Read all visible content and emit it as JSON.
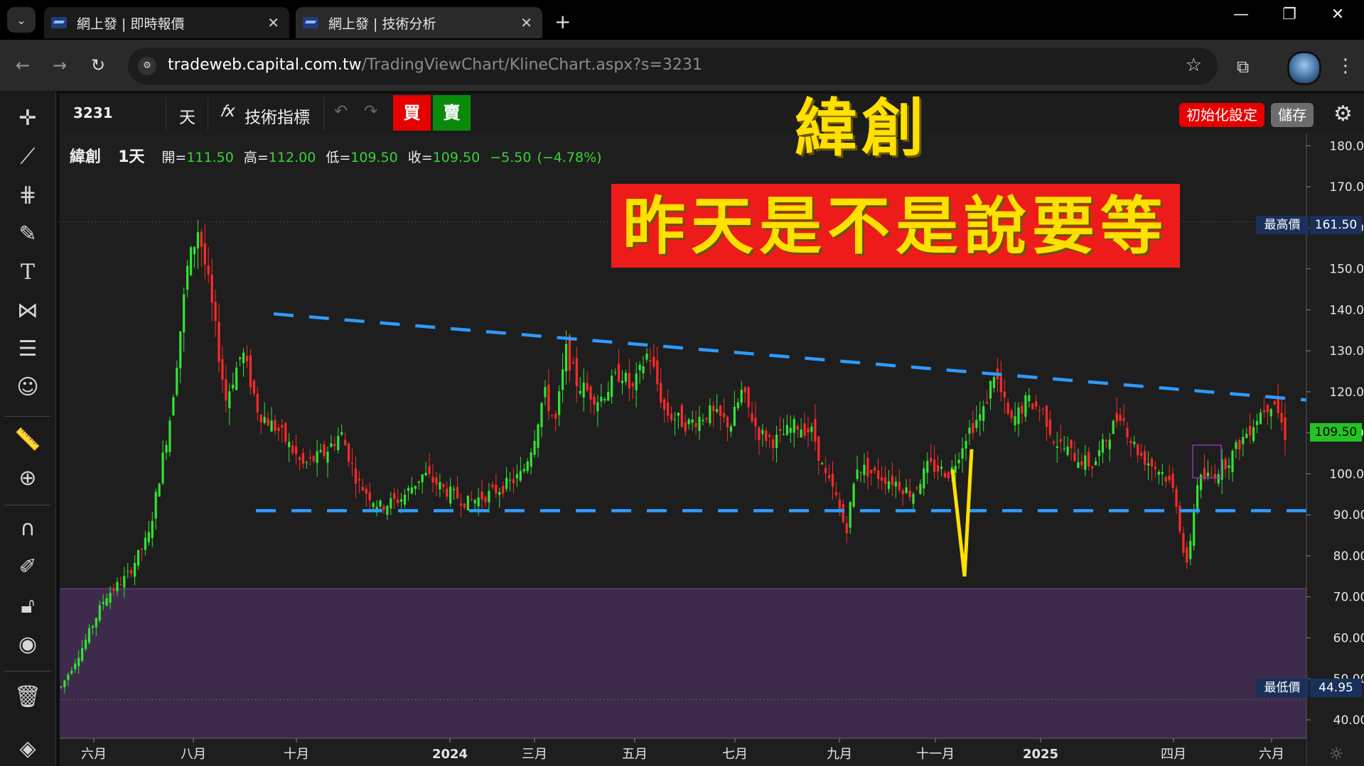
{
  "browser": {
    "tabs": [
      {
        "title": "網上發 | 即時報價",
        "close": "✕"
      },
      {
        "title": "網上發 | 技術分析",
        "close": "✕"
      }
    ],
    "new_tab": "+",
    "window": {
      "minimize": "—",
      "restore": "❐",
      "close": "✕"
    },
    "url_host": "tradeweb.capital.com.tw",
    "url_path": "/TradingViewChart/KlineChart.aspx?s=3231"
  },
  "toolbar": {
    "symbol": "3231",
    "interval": "天",
    "fx_icon": "𝑓x",
    "indicators": "技術指標",
    "buy": "買",
    "sell": "賣",
    "init_settings": "初始化設定",
    "save": "儲存"
  },
  "overlay": {
    "title": "緯創",
    "banner": "昨天是不是說要等"
  },
  "legend": {
    "name": "緯創",
    "interval": "1天",
    "open_label": "開=",
    "open": "111.50",
    "high_label": "高=",
    "high": "112.00",
    "low_label": "低=",
    "low": "109.50",
    "close_label": "收=",
    "close": "109.50",
    "change": "−5.50",
    "change_pct": "(−4.78%)"
  },
  "price_labels": {
    "high_name": "最高價",
    "high_value": "161.50",
    "low_name": "最低價",
    "low_value": "44.95",
    "last_value": "109.50"
  },
  "chart_data": {
    "type": "candlestick",
    "symbol": "3231",
    "y_ticks": [
      "180.00",
      "170.00",
      "160.00",
      "150.00",
      "140.00",
      "130.00",
      "120.00",
      "110.00",
      "100.00",
      "90.00",
      "80.00",
      "70.00",
      "60.00",
      "50.00",
      "40.00"
    ],
    "ylim": [
      35.5,
      183
    ],
    "x_ticks": [
      "六月",
      "八月",
      "十月",
      "2024",
      "三月",
      "五月",
      "七月",
      "九月",
      "十一月",
      "2025",
      "四月",
      "六月"
    ],
    "colors": {
      "up": "#33e333",
      "down": "#ff2a2a",
      "trendline": "#2e9bff",
      "zone": "#3e2a4a",
      "highlight": "#ffe000",
      "last_price": "#22c322"
    },
    "price_points": [
      [
        0,
        48
      ],
      [
        0.02,
        58
      ],
      [
        0.04,
        70
      ],
      [
        0.06,
        75
      ],
      [
        0.08,
        85
      ],
      [
        0.1,
        115
      ],
      [
        0.115,
        150
      ],
      [
        0.125,
        160
      ],
      [
        0.135,
        145
      ],
      [
        0.15,
        118
      ],
      [
        0.165,
        130
      ],
      [
        0.18,
        115
      ],
      [
        0.2,
        110
      ],
      [
        0.22,
        102
      ],
      [
        0.24,
        105
      ],
      [
        0.255,
        110
      ],
      [
        0.27,
        98
      ],
      [
        0.29,
        92
      ],
      [
        0.31,
        94
      ],
      [
        0.33,
        100
      ],
      [
        0.35,
        96
      ],
      [
        0.37,
        93
      ],
      [
        0.39,
        95
      ],
      [
        0.41,
        98
      ],
      [
        0.42,
        100
      ],
      [
        0.43,
        108
      ],
      [
        0.44,
        120
      ],
      [
        0.45,
        112
      ],
      [
        0.46,
        130
      ],
      [
        0.47,
        122
      ],
      [
        0.49,
        118
      ],
      [
        0.51,
        125
      ],
      [
        0.52,
        120
      ],
      [
        0.535,
        130
      ],
      [
        0.55,
        115
      ],
      [
        0.57,
        112
      ],
      [
        0.59,
        115
      ],
      [
        0.61,
        112
      ],
      [
        0.62,
        120
      ],
      [
        0.635,
        110
      ],
      [
        0.65,
        108
      ],
      [
        0.67,
        112
      ],
      [
        0.685,
        110
      ],
      [
        0.695,
        100
      ],
      [
        0.705,
        95
      ],
      [
        0.715,
        86
      ],
      [
        0.725,
        102
      ],
      [
        0.74,
        100
      ],
      [
        0.76,
        98
      ],
      [
        0.775,
        95
      ],
      [
        0.79,
        102
      ],
      [
        0.81,
        100
      ],
      [
        0.825,
        110
      ],
      [
        0.84,
        115
      ],
      [
        0.85,
        125
      ],
      [
        0.865,
        112
      ],
      [
        0.88,
        118
      ],
      [
        0.895,
        115
      ],
      [
        0.905,
        108
      ],
      [
        0.925,
        104
      ],
      [
        0.94,
        102
      ],
      [
        0.955,
        110
      ],
      [
        0.965,
        115
      ],
      [
        0.975,
        108
      ],
      [
        0.985,
        104
      ],
      [
        0.995,
        102
      ],
      [
        1.005,
        100
      ],
      [
        1.015,
        95
      ],
      [
        1.025,
        76
      ],
      [
        1.035,
        98
      ],
      [
        1.05,
        100
      ],
      [
        1.065,
        104
      ],
      [
        1.08,
        110
      ],
      [
        1.095,
        116
      ],
      [
        1.105,
        118
      ],
      [
        1.115,
        109.5
      ]
    ],
    "trendlines": [
      {
        "name": "resistance",
        "points": [
          [
            245,
            139
          ],
          [
            1570,
            118
          ]
        ]
      },
      {
        "name": "support",
        "points": [
          [
            220,
            91
          ],
          [
            1570,
            91
          ]
        ]
      }
    ],
    "highlight_v": {
      "points": [
        [
          1340,
          101
        ],
        [
          1357,
          75
        ],
        [
          1367,
          106
        ]
      ]
    },
    "zone": {
      "from_price": 72,
      "to_price": 35.5
    },
    "high_price": 161.5,
    "low_price": 44.95,
    "last_price": 109.5
  }
}
